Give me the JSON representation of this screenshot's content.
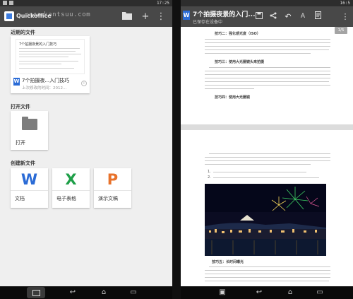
{
  "left": {
    "status_time": "17:25",
    "watermark": "www.kantsuu.com",
    "app_title": "Quickoffice",
    "appbar_icons": [
      "folder-icon",
      "add-icon",
      "overflow-menu-icon"
    ],
    "section_recent": "近期的文件",
    "recent_file": {
      "thumb_title": "7个拍摄夜景的入门技巧",
      "name": "7个拍摄夜...入门技巧",
      "subtitle": "上次修改的时间：2012..."
    },
    "section_open": "打开文件",
    "open_label": "打开",
    "section_new": "创建新文件",
    "new_items": [
      {
        "glyph": "W",
        "label": "文档",
        "color": "#2a6bd6"
      },
      {
        "glyph": "X",
        "label": "电子表格",
        "color": "#1e9f48"
      },
      {
        "glyph": "P",
        "label": "演示文稿",
        "color": "#e8722b"
      }
    ]
  },
  "right": {
    "status_time": "16:5",
    "doc_title": "7个拍摄夜景的入门...",
    "doc_subtitle": "已保存在设备中",
    "appbar_icons": [
      "save-icon",
      "share-icon",
      "undo-icon",
      "text-format-icon",
      "document-icon",
      "overflow-menu-icon"
    ],
    "page_indicator": "1/5",
    "page1_headings": [
      "技巧二：强化感光度（ISO）",
      "技巧三：使用大光圈镜头来拍摄",
      "技巧四：使用大光圈镜"
    ],
    "page2_notes": [
      "1.",
      "2."
    ],
    "page2_heading": "技巧五：长时间曝光"
  },
  "colors": {
    "appbar": "#484848",
    "word_blue": "#2a6bd6",
    "excel_green": "#1e9f48",
    "ppt_orange": "#e8722b"
  }
}
